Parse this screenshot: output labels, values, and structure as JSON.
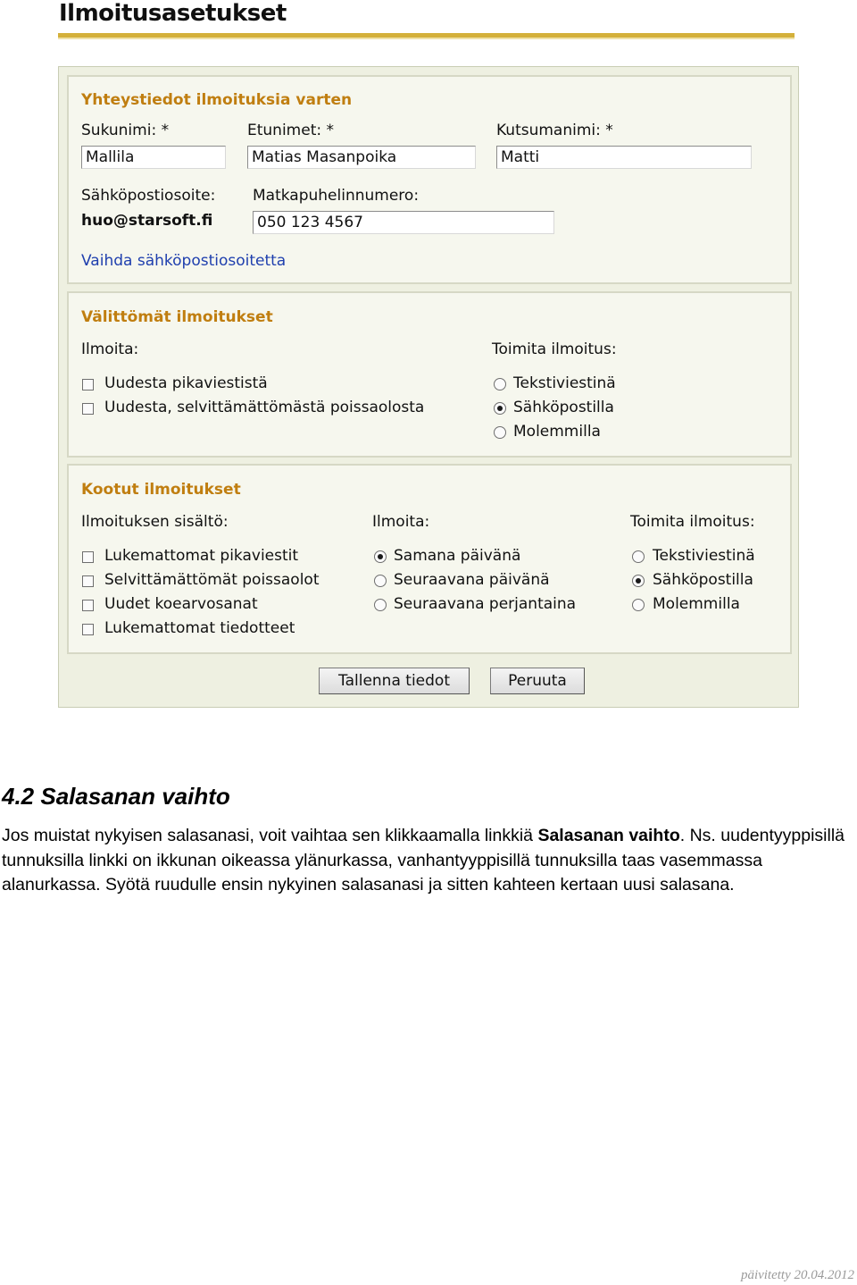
{
  "page_title": "Ilmoitusasetukset",
  "contact": {
    "title": "Yhteystiedot ilmoituksia varten",
    "surname_label": "Sukunimi: *",
    "surname_value": "Mallila",
    "firstnames_label": "Etunimet: *",
    "firstnames_value": "Matias Masanpoika",
    "nickname_label": "Kutsumanimi: *",
    "nickname_value": "Matti",
    "email_label": "Sähköpostiosoite:",
    "email_value": "huo@starsoft.fi",
    "mobile_label": "Matkapuhelinnumero:",
    "mobile_value": "050 123 4567",
    "change_email_link": "Vaihda sähköpostiosoitetta"
  },
  "immediate": {
    "title": "Välittömät ilmoitukset",
    "notify_label": "Ilmoita:",
    "notify_options": [
      {
        "label": "Uudesta pikaviestistä",
        "checked": false
      },
      {
        "label": "Uudesta, selvittämättömästä poissaolosta",
        "checked": false
      }
    ],
    "deliver_label": "Toimita ilmoitus:",
    "deliver_options": [
      {
        "label": "Tekstiviestinä",
        "selected": false
      },
      {
        "label": "Sähköpostilla",
        "selected": true
      },
      {
        "label": "Molemmilla",
        "selected": false
      }
    ]
  },
  "digest": {
    "title": "Kootut ilmoitukset",
    "content_label": "Ilmoituksen sisältö:",
    "content_options": [
      {
        "label": "Lukemattomat pikaviestit",
        "checked": false
      },
      {
        "label": "Selvittämättömät poissaolot",
        "checked": false
      },
      {
        "label": "Uudet koearvosanat",
        "checked": false
      },
      {
        "label": "Lukemattomat tiedotteet",
        "checked": false
      }
    ],
    "notify_label": "Ilmoita:",
    "notify_options": [
      {
        "label": "Samana päivänä",
        "selected": true
      },
      {
        "label": "Seuraavana päivänä",
        "selected": false
      },
      {
        "label": "Seuraavana perjantaina",
        "selected": false
      }
    ],
    "deliver_label": "Toimita ilmoitus:",
    "deliver_options": [
      {
        "label": "Tekstiviestinä",
        "selected": false
      },
      {
        "label": "Sähköpostilla",
        "selected": true
      },
      {
        "label": "Molemmilla",
        "selected": false
      }
    ]
  },
  "buttons": {
    "save": "Tallenna tiedot",
    "cancel": "Peruuta"
  },
  "document": {
    "heading": "4.2 Salasanan vaihto",
    "para_part1": "Jos muistat nykyisen salasanasi, voit vaihtaa sen klikkaamalla linkkiä ",
    "para_bold": "Salasanan vaihto",
    "para_part2": ". Ns. uudentyyppisillä tunnuksilla linkki on ikkunan oikeassa ylänurkassa, vanhantyyppisillä tunnuksilla taas vasemmassa alanurkassa. Syötä ruudulle ensin nykyinen salasanasi ja sitten kahteen kertaan uusi salasana.",
    "footer": "päivitetty 20.04.2012"
  }
}
